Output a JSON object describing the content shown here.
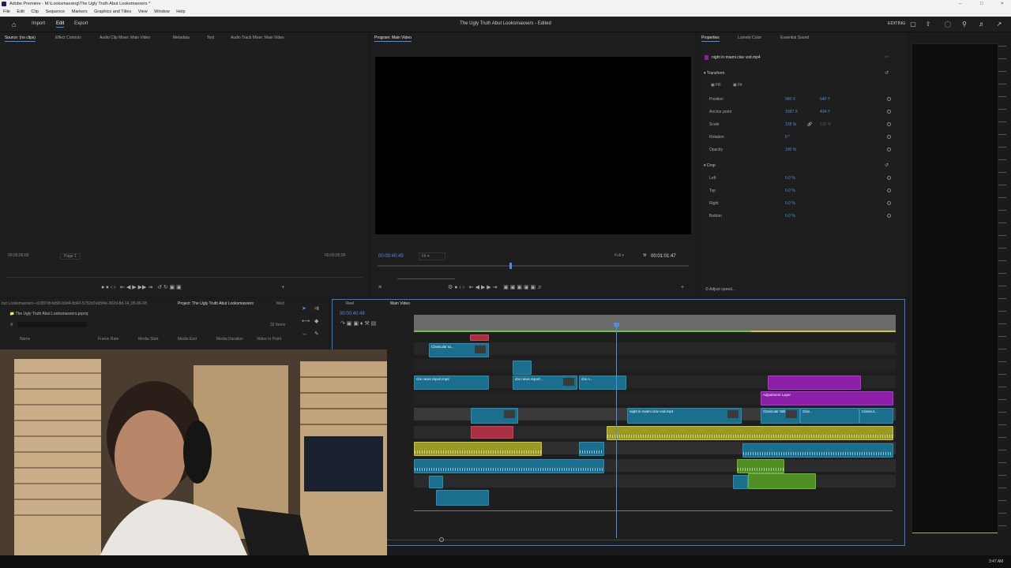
{
  "window": {
    "title": "Adobe Premiere - M:\\Looksmaxxing\\The Ugly Truth Abut Looksmaxxers *"
  },
  "menu": [
    "File",
    "Edit",
    "Clip",
    "Sequence",
    "Markers",
    "Graphics and Titles",
    "View",
    "Window",
    "Help"
  ],
  "workspace": {
    "tabs": [
      "Import",
      "Edit",
      "Export"
    ],
    "active_tab": "Edit",
    "doc_title": "The Ugly Truth Abut Looksmaxxers - Edited",
    "editing_label": "EDITING"
  },
  "source_panel": {
    "tabs": [
      "Source: (no clips)",
      "Effect Controls",
      "Audio Clip Mixer: Main Video",
      "Metadata",
      "Text",
      "Audio Track Mixer: Main Video"
    ],
    "timecode_left": "00;00;00;00",
    "timecode_right": "00;00;00;00",
    "page": "Page 1"
  },
  "program_panel": {
    "tab": "Program: Main Video",
    "timecode": "00:00:40:49",
    "fit": "Fit",
    "quality": "Full",
    "duration": "00:01:01:47"
  },
  "properties_panel": {
    "tabs": [
      "Properties",
      "Lumetri Color",
      "Essential Sound"
    ],
    "clip_name": "night in miami clav vod.mp4",
    "transform_label": "Transform",
    "fill_label": "Fill",
    "fit_label": "Fit",
    "rows": [
      {
        "label": "Position",
        "v1": "960 X",
        "v2": "540 Y"
      },
      {
        "label": "Anchor point",
        "v1": "1097 X",
        "v2": "434 Y"
      },
      {
        "label": "Scale",
        "v1": "128 %",
        "v2": "100 %"
      },
      {
        "label": "Rotation",
        "v1": "0 °",
        "v2": ""
      },
      {
        "label": "Opacity",
        "v1": "100 %",
        "v2": ""
      }
    ],
    "crop_label": "Crop",
    "crop_rows": [
      {
        "label": "Left",
        "v1": "0.0 %"
      },
      {
        "label": "Top",
        "v1": "0.0 %"
      },
      {
        "label": "Right",
        "v1": "0.0 %"
      },
      {
        "label": "Bottom",
        "v1": "0.0 %"
      }
    ],
    "footer": "Adjust speed..."
  },
  "project_panel": {
    "path": "but Looksmaxxers--d1887df-bd90-b9d4-8d43-5752d7eb5f4e-302d-8d-14_05-06-08",
    "tab": "Project: The Ugly Truth Abut Looksmaxxers",
    "extra_tab": "Med",
    "project_file": "The Ugly Truth Abut Looksmaxxers.prproj",
    "item_count": "32 Items",
    "columns": [
      "Name",
      "Frame Rate",
      "Media Start",
      "Media End",
      "Media Duration",
      "Video In Point"
    ]
  },
  "timeline": {
    "tabs": [
      "Reel",
      "Main Video"
    ],
    "active_tab": "Main Video",
    "timecode": "00:00:40:49",
    "clips": [
      {
        "label": "Clavicular ta...",
        "color": "teal"
      },
      {
        "label": "cbs news report.mp4",
        "color": "teal"
      },
      {
        "label": "cbs news report...",
        "color": "teal"
      },
      {
        "label": "cbs n...",
        "color": "teal"
      },
      {
        "label": "Adjustment Layer",
        "color": "purple"
      },
      {
        "label": "night in miami clav vod.mp4",
        "color": "teal"
      },
      {
        "label": "Clavicular Still...",
        "color": "teal"
      },
      {
        "label": "Clav...",
        "color": "teal"
      },
      {
        "label": "Clavicul...",
        "color": "teal"
      }
    ]
  },
  "taskbar": {
    "clock": "3:47 AM"
  }
}
